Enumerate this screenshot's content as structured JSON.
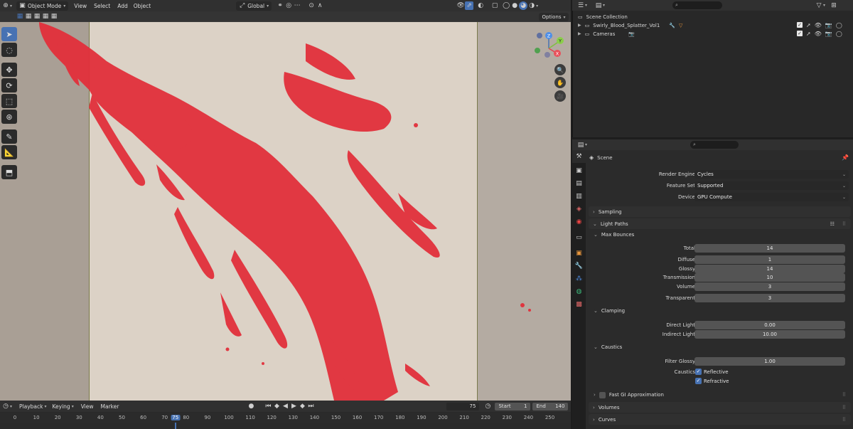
{
  "viewport": {
    "header": {
      "mode": "Object Mode",
      "menus": [
        "View",
        "Select",
        "Add",
        "Object"
      ],
      "orientation": "Global",
      "options_label": "Options"
    },
    "gizmo_axes": [
      "Z",
      "Y",
      "X"
    ]
  },
  "timeline": {
    "menus": [
      "Playback",
      "Keying",
      "View",
      "Marker"
    ],
    "current_frame": "75",
    "start_label": "Start",
    "start": "1",
    "end_label": "End",
    "end": "140",
    "ruler": [
      "0",
      "10",
      "20",
      "30",
      "40",
      "50",
      "60",
      "70",
      "75",
      "80",
      "90",
      "100",
      "110",
      "120",
      "130",
      "140",
      "150",
      "160",
      "170",
      "180",
      "190",
      "200",
      "210",
      "220",
      "230",
      "240",
      "250"
    ]
  },
  "outliner": {
    "root": "Scene Collection",
    "items": [
      {
        "name": "Swirly_Blood_Splatter_Vol1"
      },
      {
        "name": "Cameras"
      }
    ]
  },
  "properties": {
    "context": "Scene",
    "render_engine_label": "Render Engine",
    "render_engine": "Cycles",
    "feature_set_label": "Feature Set",
    "feature_set": "Supported",
    "device_label": "Device",
    "device": "GPU Compute",
    "sampling": "Sampling",
    "light_paths": "Light Paths",
    "max_bounces": "Max Bounces",
    "bounces": [
      {
        "label": "Total",
        "value": "14"
      },
      {
        "label": "Diffuse",
        "value": "1"
      },
      {
        "label": "Glossy",
        "value": "14"
      },
      {
        "label": "Transmission",
        "value": "10"
      },
      {
        "label": "Volume",
        "value": "3"
      },
      {
        "label": "Transparent",
        "value": "3"
      }
    ],
    "clamping": "Clamping",
    "direct_light_label": "Direct Light",
    "direct_light": "0.00",
    "indirect_light_label": "Indirect Light",
    "indirect_light": "10.00",
    "caustics": "Caustics",
    "filter_glossy_label": "Filter Glossy",
    "filter_glossy": "1.00",
    "caustics_label": "Caustics",
    "reflective": "Reflective",
    "refractive": "Refractive",
    "fast_gi": "Fast GI Approximation",
    "volumes": "Volumes",
    "curves": "Curves"
  },
  "colors": {
    "accent": "#4772b3",
    "splatter": "#e2303b",
    "paper": "#dcd2c6"
  }
}
